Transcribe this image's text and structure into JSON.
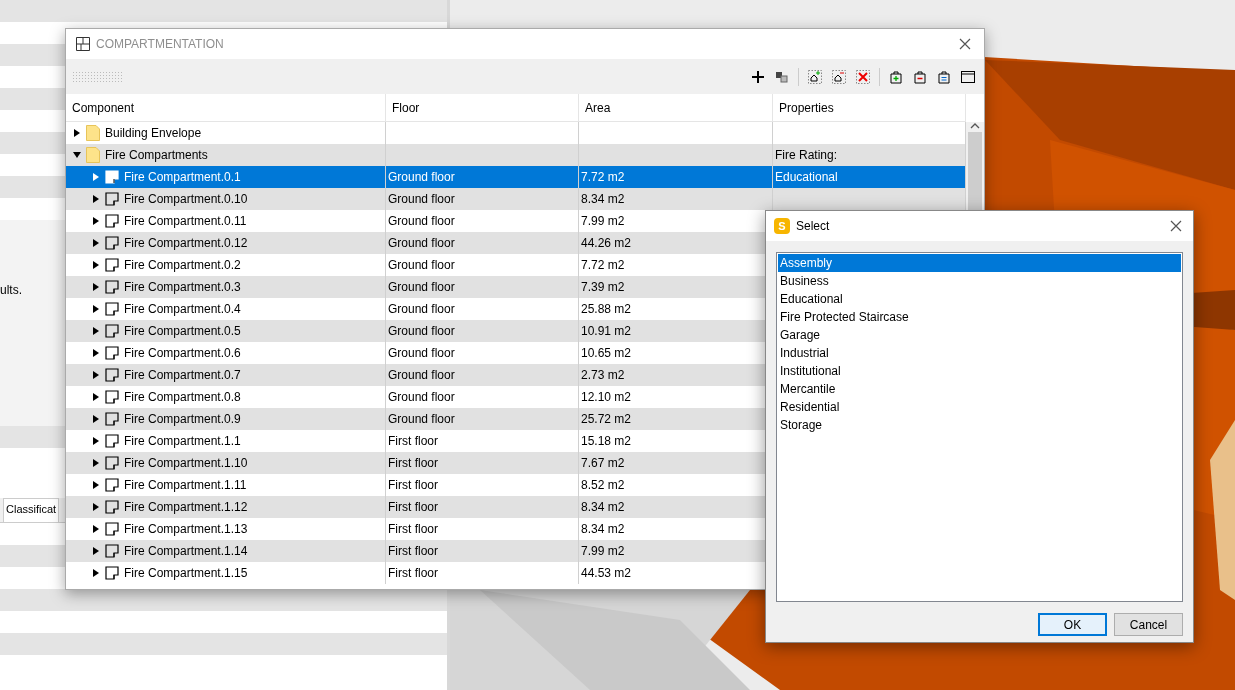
{
  "left_panel": {
    "text_fragment": "ults.",
    "tab_label": "Classificat"
  },
  "compartmentation": {
    "title": "COMPARTMENTATION",
    "columns": [
      "Component",
      "Floor",
      "Area",
      "Properties"
    ],
    "rows": [
      {
        "kind": "folder",
        "label": "Building Envelope",
        "expanded": false,
        "selected": false
      },
      {
        "kind": "folder",
        "label": "Fire Compartments",
        "expanded": true,
        "selected": false,
        "properties": "Fire Rating:",
        "children": [
          {
            "kind": "compartment",
            "label": "Fire Compartment.0.1",
            "floor": "Ground floor",
            "area": "7.72 m2",
            "properties": "Educational",
            "expanded": false,
            "selected": true
          },
          {
            "kind": "compartment",
            "label": "Fire Compartment.0.10",
            "floor": "Ground floor",
            "area": "8.34 m2",
            "expanded": false,
            "selected": false
          },
          {
            "kind": "compartment",
            "label": "Fire Compartment.0.11",
            "floor": "Ground floor",
            "area": "7.99 m2",
            "expanded": false,
            "selected": false
          },
          {
            "kind": "compartment",
            "label": "Fire Compartment.0.12",
            "floor": "Ground floor",
            "area": "44.26 m2",
            "expanded": false,
            "selected": false
          },
          {
            "kind": "compartment",
            "label": "Fire Compartment.0.2",
            "floor": "Ground floor",
            "area": "7.72 m2",
            "expanded": false,
            "selected": false
          },
          {
            "kind": "compartment",
            "label": "Fire Compartment.0.3",
            "floor": "Ground floor",
            "area": "7.39 m2",
            "expanded": false,
            "selected": false
          },
          {
            "kind": "compartment",
            "label": "Fire Compartment.0.4",
            "floor": "Ground floor",
            "area": "25.88 m2",
            "expanded": false,
            "selected": false
          },
          {
            "kind": "compartment",
            "label": "Fire Compartment.0.5",
            "floor": "Ground floor",
            "area": "10.91 m2",
            "expanded": false,
            "selected": false
          },
          {
            "kind": "compartment",
            "label": "Fire Compartment.0.6",
            "floor": "Ground floor",
            "area": "10.65 m2",
            "expanded": false,
            "selected": false
          },
          {
            "kind": "compartment",
            "label": "Fire Compartment.0.7",
            "floor": "Ground floor",
            "area": "2.73 m2",
            "expanded": false,
            "selected": false
          },
          {
            "kind": "compartment",
            "label": "Fire Compartment.0.8",
            "floor": "Ground floor",
            "area": "12.10 m2",
            "expanded": false,
            "selected": false
          },
          {
            "kind": "compartment",
            "label": "Fire Compartment.0.9",
            "floor": "Ground floor",
            "area": "25.72 m2",
            "expanded": false,
            "selected": false
          },
          {
            "kind": "compartment",
            "label": "Fire Compartment.1.1",
            "floor": "First floor",
            "area": "15.18 m2",
            "expanded": false,
            "selected": false
          },
          {
            "kind": "compartment",
            "label": "Fire Compartment.1.10",
            "floor": "First floor",
            "area": "7.67 m2",
            "expanded": false,
            "selected": false
          },
          {
            "kind": "compartment",
            "label": "Fire Compartment.1.11",
            "floor": "First floor",
            "area": "8.52 m2",
            "expanded": false,
            "selected": false
          },
          {
            "kind": "compartment",
            "label": "Fire Compartment.1.12",
            "floor": "First floor",
            "area": "8.34 m2",
            "expanded": false,
            "selected": false
          },
          {
            "kind": "compartment",
            "label": "Fire Compartment.1.13",
            "floor": "First floor",
            "area": "8.34 m2",
            "expanded": false,
            "selected": false
          },
          {
            "kind": "compartment",
            "label": "Fire Compartment.1.14",
            "floor": "First floor",
            "area": "7.99 m2",
            "expanded": false,
            "selected": false
          },
          {
            "kind": "compartment",
            "label": "Fire Compartment.1.15",
            "floor": "First floor",
            "area": "44.53 m2",
            "expanded": false,
            "selected": false
          }
        ]
      }
    ]
  },
  "select_dialog": {
    "title": "Select",
    "icon_letter": "S",
    "options": [
      {
        "label": "Assembly",
        "selected": true
      },
      {
        "label": "Business",
        "selected": false
      },
      {
        "label": "Educational",
        "selected": false
      },
      {
        "label": "Fire Protected Staircase",
        "selected": false
      },
      {
        "label": "Garage",
        "selected": false
      },
      {
        "label": "Industrial",
        "selected": false
      },
      {
        "label": "Institutional",
        "selected": false
      },
      {
        "label": "Mercantile",
        "selected": false
      },
      {
        "label": "Residential",
        "selected": false
      },
      {
        "label": "Storage",
        "selected": false
      }
    ],
    "buttons": [
      {
        "label": "OK",
        "default": true
      },
      {
        "label": "Cancel",
        "default": false
      }
    ]
  }
}
